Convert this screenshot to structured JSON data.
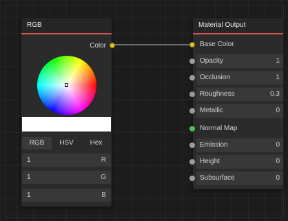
{
  "rgb_node": {
    "title": "RGB",
    "output_label": "Color",
    "swatch_color": "#ffffff",
    "modes": [
      "RGB",
      "HSV",
      "Hex"
    ],
    "active_mode": "RGB",
    "channels": [
      {
        "value": "1",
        "name": "R"
      },
      {
        "value": "1",
        "name": "G"
      },
      {
        "value": "1",
        "name": "B"
      }
    ]
  },
  "output_node": {
    "title": "Material Output",
    "inputs": [
      {
        "label": "Base Color",
        "value": "",
        "socket": "yellow",
        "field": false
      },
      {
        "label": "Opacity",
        "value": "1",
        "socket": "grey",
        "field": true
      },
      {
        "label": "Occlusion",
        "value": "1",
        "socket": "grey",
        "field": true
      },
      {
        "label": "Roughness",
        "value": "0.3",
        "socket": "grey",
        "field": true
      },
      {
        "label": "Metallic",
        "value": "0",
        "socket": "grey",
        "field": true
      },
      {
        "label": "Normal Map",
        "value": "",
        "socket": "green",
        "field": false
      },
      {
        "label": "Emission",
        "value": "0",
        "socket": "grey",
        "field": true
      },
      {
        "label": "Height",
        "value": "0",
        "socket": "grey",
        "field": true
      },
      {
        "label": "Subsurface",
        "value": "0",
        "socket": "grey",
        "field": true
      }
    ]
  },
  "colors": {
    "header_accent": "#d9534f",
    "socket_color": "#e7c41a",
    "socket_float": "#9c9c9c",
    "socket_vector": "#4cbf4c",
    "wire": "#bdbdbd"
  }
}
